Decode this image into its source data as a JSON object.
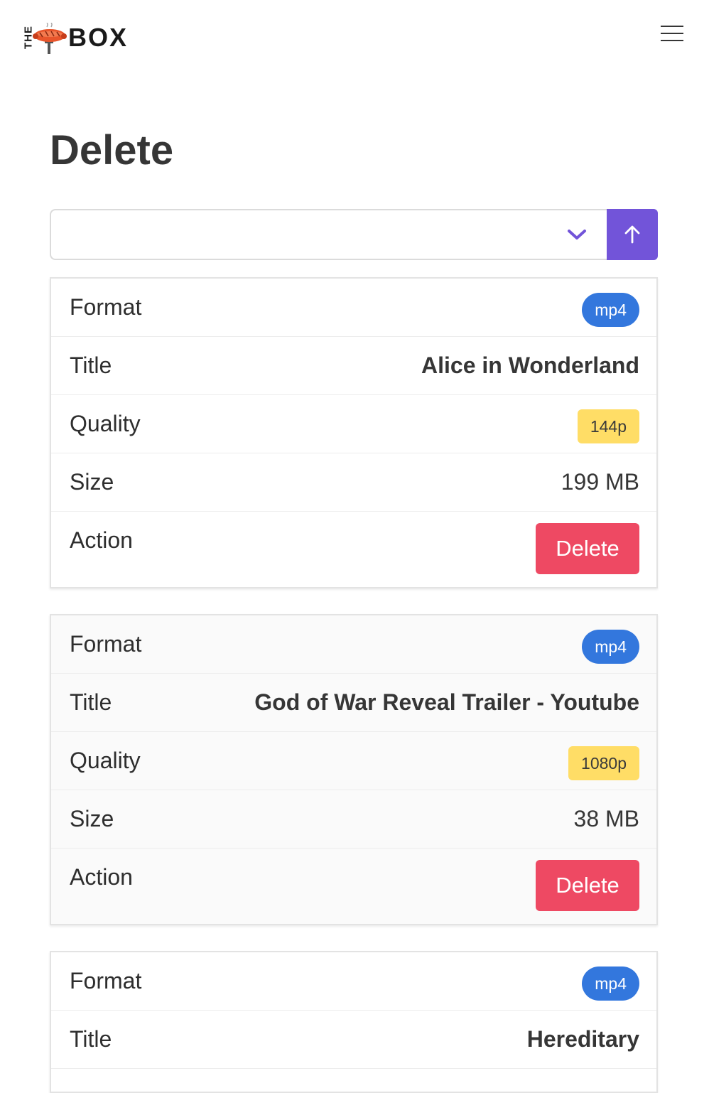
{
  "brand": {
    "the": "THE",
    "box": "BOX"
  },
  "page": {
    "title": "Delete"
  },
  "items": [
    {
      "format_label": "Format",
      "format": "mp4",
      "title_label": "Title",
      "title": "Alice in Wonderland",
      "quality_label": "Quality",
      "quality": "144p",
      "size_label": "Size",
      "size": "199 MB",
      "action_label": "Action",
      "delete_label": "Delete"
    },
    {
      "format_label": "Format",
      "format": "mp4",
      "title_label": "Title",
      "title": "God of War Reveal Trailer - Youtube",
      "quality_label": "Quality",
      "quality": "1080p",
      "size_label": "Size",
      "size": "38 MB",
      "action_label": "Action",
      "delete_label": "Delete"
    },
    {
      "format_label": "Format",
      "format": "mp4",
      "title_label": "Title",
      "title": "Hereditary"
    }
  ],
  "colors": {
    "accent": "#7254d9",
    "format_tag": "#3377dd",
    "quality_tag": "#ffdd66",
    "delete": "#ee4963"
  },
  "icons": {
    "menu": "hamburger-icon",
    "dropdown": "chevron-down-icon",
    "submit": "arrow-up-icon",
    "logo": "sausage-fork-icon"
  }
}
